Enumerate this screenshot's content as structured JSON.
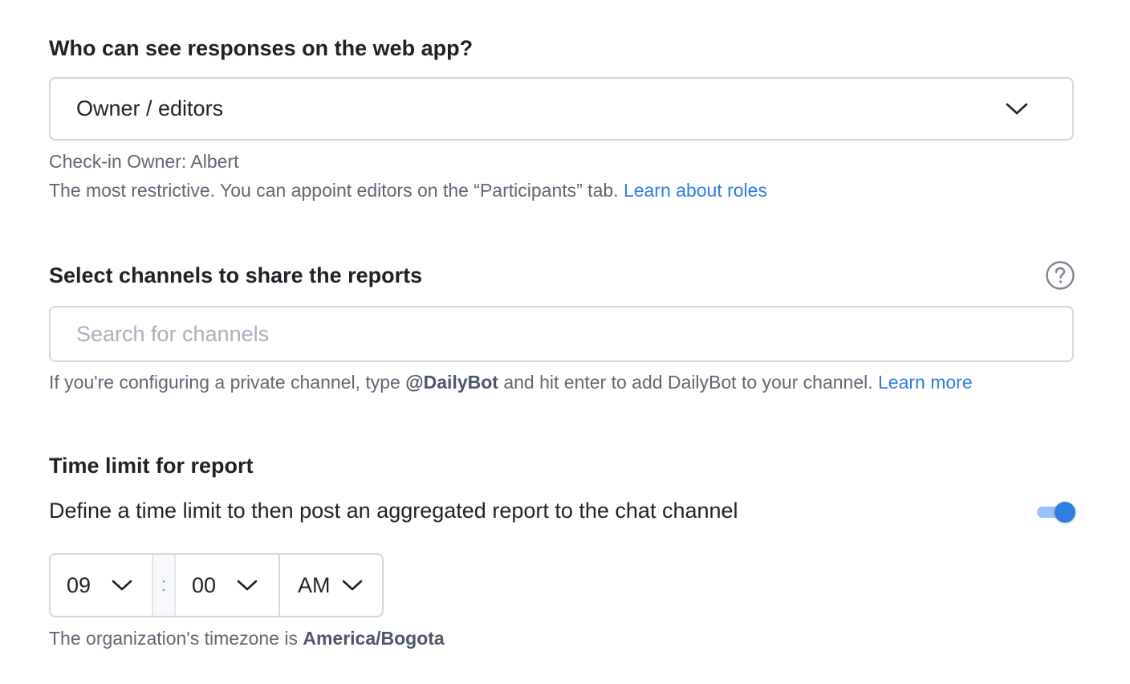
{
  "visibility": {
    "title": "Who can see responses on the web app?",
    "selected": "Owner / editors",
    "owner_line": "Check-in Owner: Albert",
    "description": "The most restrictive. You can appoint editors on the “Participants” tab.",
    "link": "Learn about roles"
  },
  "channels": {
    "title": "Select channels to share the reports",
    "placeholder": "Search for channels",
    "value": "",
    "hint_prefix": "If you're configuring a private channel, type",
    "hint_bold": "@DailyBot",
    "hint_suffix": "and hit enter to add DailyBot to your channel.",
    "link": "Learn more"
  },
  "time_limit": {
    "title": "Time limit for report",
    "description": "Define a time limit to then post an aggregated report to the chat channel",
    "enabled": true,
    "hour": "09",
    "separator": ":",
    "minute": "00",
    "ampm": "AM",
    "timezone_prefix": "The organization's timezone is",
    "timezone": "America/Bogota"
  },
  "colors": {
    "accent": "#2f7de1",
    "border": "#d3d6dc",
    "muted_text": "#5e6773"
  }
}
